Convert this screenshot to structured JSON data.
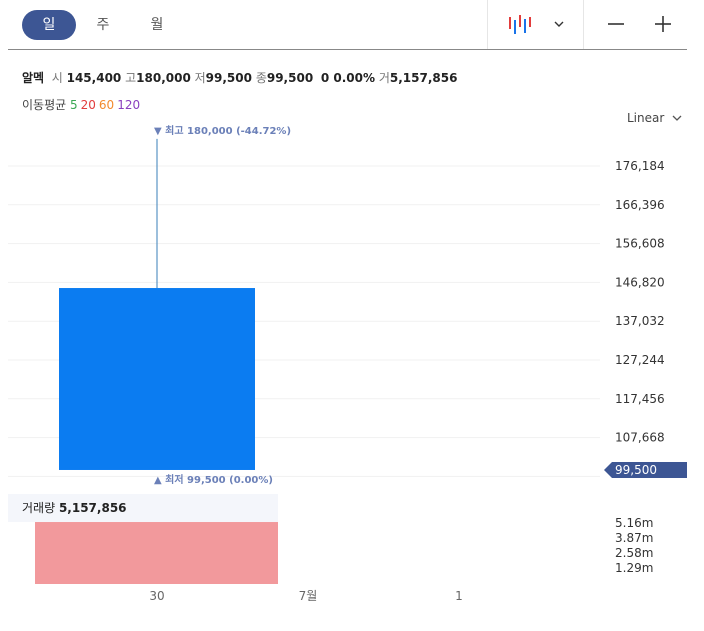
{
  "toolbar": {
    "periods": [
      "일",
      "주",
      "월"
    ],
    "active_period": "일",
    "chart_type_icon": "candlestick-icon",
    "dropdown_icon": "chevron-down-icon",
    "zoom_out_icon": "minus-icon",
    "zoom_in_icon": "plus-icon"
  },
  "info": {
    "name": "알멕",
    "open_label": "시",
    "open": "145,400",
    "high_label": "고",
    "high": "180,000",
    "low_label": "저",
    "low": "99,500",
    "close_label": "종",
    "close": "99,500",
    "change": "0 0.00%",
    "volume_label": "거",
    "volume": "5,157,856"
  },
  "moving_average": {
    "label": "이동평균",
    "periods": [
      {
        "value": "5",
        "color": "#3aa853"
      },
      {
        "value": "20",
        "color": "#e23c3c"
      },
      {
        "value": "60",
        "color": "#f28a2d"
      },
      {
        "value": "120",
        "color": "#8a3fbf"
      }
    ]
  },
  "scale_label": "Linear",
  "colors": {
    "accent": "#3d5694",
    "candle_down": "#0b7cf1",
    "volume_bar": "#f2999c",
    "marker_text": "#6b80b8"
  },
  "chart_data": {
    "type": "candlestick",
    "candles": [
      {
        "x": "30",
        "open": 145400,
        "high": 180000,
        "low": 99500,
        "close": 99500
      }
    ],
    "volume": [
      {
        "x": "30",
        "value": 5157856
      }
    ],
    "high_marker": "최고 180,000 (-44.72%)",
    "low_marker": "최저 99,500 (0.00%)",
    "y_ticks": [
      "176,184",
      "166,396",
      "156,608",
      "146,820",
      "137,032",
      "127,244",
      "117,456",
      "107,668"
    ],
    "last_price_label": "99,500",
    "volume_label": "거래량",
    "volume_value": "5,157,856",
    "volume_ticks": [
      "5.16m",
      "3.87m",
      "2.58m",
      "1.29m"
    ],
    "x_ticks": [
      "30",
      "7월",
      "1"
    ],
    "grid": true
  }
}
